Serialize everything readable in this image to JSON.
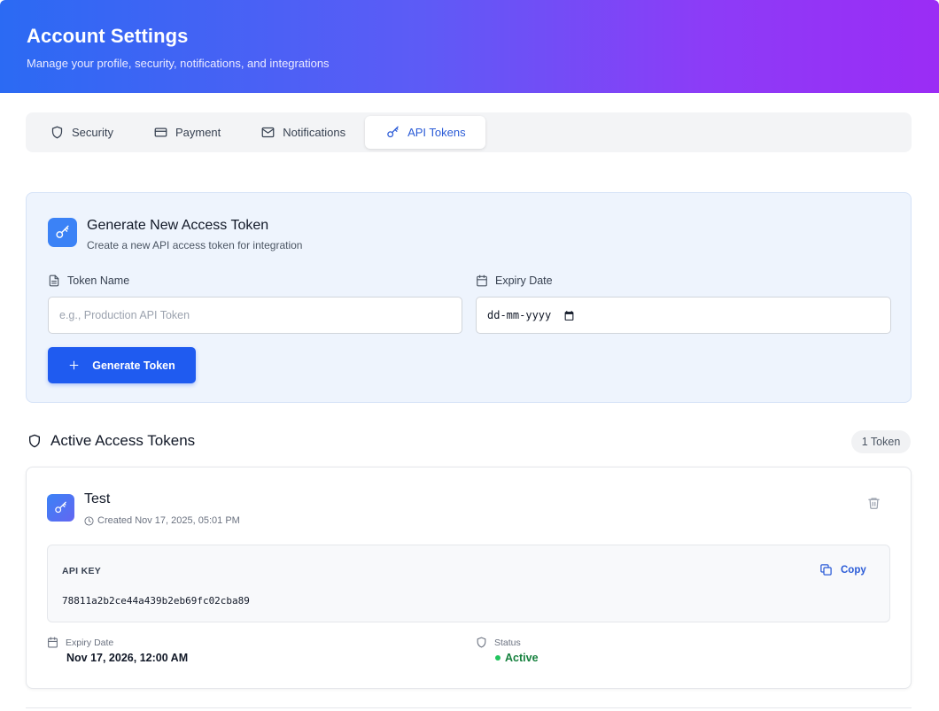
{
  "header": {
    "title": "Account Settings",
    "subtitle": "Manage your profile, security, notifications, and integrations"
  },
  "tabs": [
    {
      "label": "Security",
      "icon": "shield-icon",
      "active": false
    },
    {
      "label": "Payment",
      "icon": "credit-card-icon",
      "active": false
    },
    {
      "label": "Notifications",
      "icon": "mail-icon",
      "active": false
    },
    {
      "label": "API Tokens",
      "icon": "key-icon",
      "active": true
    }
  ],
  "generate": {
    "title": "Generate New Access Token",
    "subtitle": "Create a new API access token for integration",
    "token_name_label": "Token Name",
    "token_name_placeholder": "e.g., Production API Token",
    "token_name_value": "",
    "expiry_label": "Expiry Date",
    "expiry_placeholder": "dd-mm-yyyy",
    "button_label": "Generate Token"
  },
  "active": {
    "title": "Active Access Tokens",
    "count_label": "1 Token"
  },
  "tokens": [
    {
      "name": "Test",
      "created": "Created Nov 17, 2025, 05:01 PM",
      "api_key_label": "API KEY",
      "api_key": "78811a2b2ce44a439b2eb69fc02cba89",
      "copy_label": "Copy",
      "expiry_label": "Expiry Date",
      "expiry_value": "Nov 17, 2026, 12:00 AM",
      "status_label": "Status",
      "status_value": "Active"
    }
  ],
  "colors": {
    "accent": "#1f5bf0",
    "active_tab_text": "#2a5bd7",
    "status_active": "#15803d",
    "header_gradient_start": "#2b6af3",
    "header_gradient_end": "#9b2cf5"
  }
}
